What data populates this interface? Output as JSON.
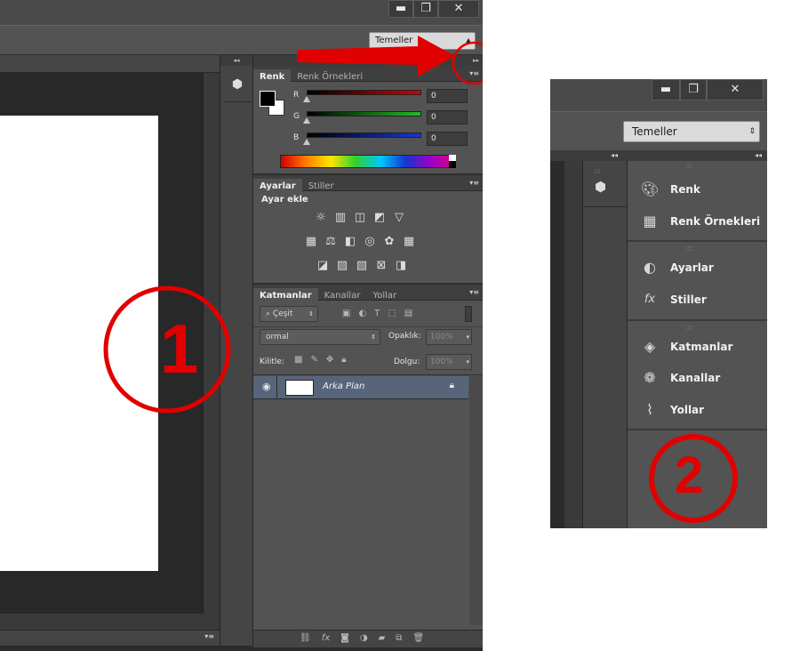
{
  "window": {
    "minimize": "▬",
    "restore": "❐",
    "close": "✕"
  },
  "workspace": {
    "label": "Temeller"
  },
  "color_panel": {
    "tabs": [
      "Renk",
      "Renk Örnekleri"
    ],
    "channels": [
      {
        "label": "R",
        "value": "0",
        "color": "#d40000"
      },
      {
        "label": "G",
        "value": "0",
        "color": "#1fbf1f"
      },
      {
        "label": "B",
        "value": "0",
        "color": "#1737d6"
      }
    ]
  },
  "adjustments_panel": {
    "tabs": [
      "Ayarlar",
      "Stiller"
    ],
    "heading": "Ayar ekle",
    "row1": [
      "brightness-icon",
      "levels-icon",
      "curves-icon",
      "exposure-icon",
      "triangle-icon"
    ],
    "row2": [
      "vibrance-icon",
      "balance-icon",
      "bw-icon",
      "photo-filter-icon",
      "mixer-icon",
      "lookup-icon"
    ],
    "row3": [
      "invert-icon",
      "posterize-icon",
      "threshold-icon",
      "selective-color-icon",
      "gradient-map-icon"
    ]
  },
  "layers_panel": {
    "tabs": [
      "Katmanlar",
      "Kanallar",
      "Yollar"
    ],
    "filter": "Çeşit",
    "blend_mode": "ormal",
    "opacity_label": "Opaklık:",
    "opacity_value": "100%",
    "lock_label": "Kilitle:",
    "fill_label": "Dolgu:",
    "fill_value": "100%",
    "layer_name": "Arka Plan",
    "footer_icons": [
      "link-icon",
      "fx-icon",
      "mask-icon",
      "adjustment-layer-icon",
      "group-folder-icon",
      "new-layer-icon",
      "trash-icon"
    ]
  },
  "annotations": {
    "circle1": "1",
    "circle2": "2",
    "accent": "#e10000"
  },
  "collapsed_panel": {
    "workspace": "Temeller",
    "groups": [
      [
        {
          "label": "Renk",
          "icon": "palette-icon"
        },
        {
          "label": "Renk Örnekleri",
          "icon": "swatches-icon"
        }
      ],
      [
        {
          "label": "Ayarlar",
          "icon": "adjustments-icon"
        },
        {
          "label": "Stiller",
          "icon": "styles-fx-icon"
        }
      ],
      [
        {
          "label": "Katmanlar",
          "icon": "layers-icon"
        },
        {
          "label": "Kanallar",
          "icon": "channels-icon"
        },
        {
          "label": "Yollar",
          "icon": "paths-icon"
        }
      ]
    ]
  }
}
